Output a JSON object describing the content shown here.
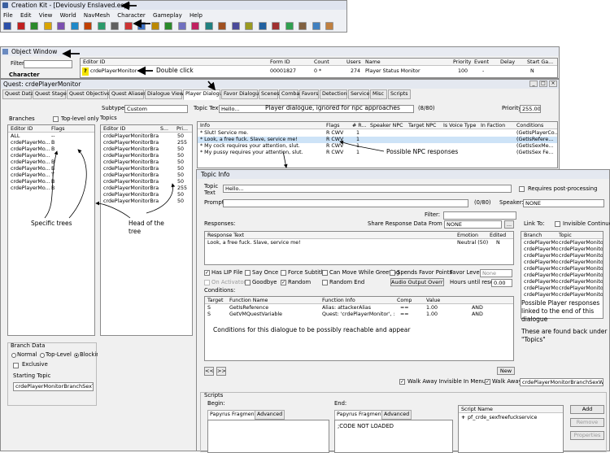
{
  "ck": {
    "title": "Creation Kit - [Deviously Enslaved.esp]",
    "menu": [
      "File",
      "Edit",
      "View",
      "World",
      "NavMesh",
      "Character",
      "Gameplay",
      "Help"
    ],
    "toolbar_colors": [
      "#2b4fa8",
      "#c02020",
      "#2b8a2b",
      "#d9a400",
      "#7a4fb0",
      "#1e88c8",
      "#c04000",
      "#2a9a6a",
      "#606060",
      "#cc3333",
      "#3b6fc4",
      "#bb8800",
      "#2a8a2a",
      "#7070c0",
      "#c02060",
      "#208080",
      "#a05020",
      "#4a4a9a",
      "#9a9a20",
      "#2060a0",
      "#a03030",
      "#30a050",
      "#806040",
      "#4080c0",
      "#c08040"
    ]
  },
  "object_window": {
    "title": "Object Window",
    "filter_label": "Filter",
    "filter_value": "",
    "tree_item": "Character",
    "columns": [
      "Editor ID",
      "Form ID",
      "Count",
      "Users",
      "Name",
      "Priority",
      "Event",
      "Delay",
      "Start Ga..."
    ],
    "row": {
      "flag": "?",
      "editor_id": "crdePlayerMonitor",
      "form_id": "00001827",
      "count": "0 *",
      "users": "274",
      "name": "Player Status Monitor",
      "priority": "100",
      "event": "-",
      "delay": "",
      "start": "N"
    }
  },
  "quest": {
    "title": "Quest: crdePlayerMonitor",
    "tabs": [
      "Quest Data",
      "Quest Stages",
      "Quest Objectives",
      "Quest Aliases",
      "Dialogue Views",
      "Player Dialogue",
      "Favor Dialogue",
      "Scenes",
      "Combat",
      "Favors",
      "Detection",
      "Service",
      "Misc",
      "Scripts"
    ],
    "active_tab": "Player Dialogue",
    "branches_label": "Branches",
    "top_level_only": "Top-level only",
    "branch_cols": [
      "Editor ID",
      "Flags"
    ],
    "branches": [
      {
        "id": "ALL",
        "flags": "--"
      },
      {
        "id": "crdePlayerMo...",
        "flags": "B"
      },
      {
        "id": "crdePlayerMo...",
        "flags": "B"
      },
      {
        "id": "crdePlayerMo...",
        "flags": ""
      },
      {
        "id": "crdePlayerMo...",
        "flags": "B"
      },
      {
        "id": "crdePlayerMo...",
        "flags": "B"
      },
      {
        "id": "crdePlayerMo...",
        "flags": "T"
      },
      {
        "id": "crdePlayerMo...",
        "flags": "B"
      },
      {
        "id": "crdePlayerMo...",
        "flags": "B"
      }
    ],
    "subtype_label": "Subtype",
    "subtype_value": "Custom",
    "topics_label": "Topics",
    "topic_cols": [
      "Editor ID",
      "S...",
      "Pri..."
    ],
    "topics": [
      {
        "id": "crdePlayerMonitorBran...",
        "s": "",
        "p": "50"
      },
      {
        "id": "crdePlayerMonitorBran...",
        "s": "",
        "p": "255"
      },
      {
        "id": "crdePlayerMonitorBran...",
        "s": "",
        "p": "50"
      },
      {
        "id": "crdePlayerMonitorBran...",
        "s": "",
        "p": "50"
      },
      {
        "id": "crdePlayerMonitorBran...",
        "s": "",
        "p": "50"
      },
      {
        "id": "crdePlayerMonitorBran...",
        "s": "",
        "p": "50"
      },
      {
        "id": "crdePlayerMonitorBran...",
        "s": "",
        "p": "50"
      },
      {
        "id": "crdePlayerMonitorBran...",
        "s": "",
        "p": "50"
      },
      {
        "id": "crdePlayerMonitorBran...",
        "s": "",
        "p": "255"
      },
      {
        "id": "crdePlayerMonitorBran...",
        "s": "",
        "p": "50"
      },
      {
        "id": "crdePlayerMonitorBran...",
        "s": "",
        "p": "50"
      }
    ],
    "topic_text_label": "Topic Text",
    "topic_text_value": "Hello...",
    "topic_text_count": "(8/80)",
    "priority_label": "Priority",
    "priority_value": "255.00",
    "info_cols": [
      "Info",
      "Flags",
      "# R...",
      "Speaker NPC",
      "Target NPC",
      "Is Voice Type",
      "In Faction",
      "Conditions"
    ],
    "infos": [
      {
        "info": "* Slut! Service me.",
        "flags": "R CWV",
        "r": "1",
        "cond": "(GetIsPlayerCo..."
      },
      {
        "info": "* Look, a free fuck. Slave, service me!",
        "flags": "R CWV",
        "r": "1",
        "cond": "(GetIsRefere..."
      },
      {
        "info": "* My cock requires your attention, slut.",
        "flags": "R CWV",
        "r": "1",
        "cond": "(GetIsSexMe..."
      },
      {
        "info": "* My pussy requires your attention, slut.",
        "flags": "R CWV",
        "r": "1",
        "cond": "(GetIsSex Fe..."
      }
    ],
    "branch_data_label": "Branch Data",
    "branch_types": [
      "Normal",
      "Top-Level",
      "Blocking"
    ],
    "exclusive_label": "Exclusive",
    "starting_topic_label": "Starting Topic",
    "starting_topic_value": "crdePlayerMonitorBranchSexTo..."
  },
  "topic_info": {
    "title": "Topic Info",
    "topic_label": "Topic Text",
    "topic_value": "Hello...",
    "requires_pp": "Requires post-processing",
    "prompt_label": "Prompt:",
    "prompt_count": "(0/80)",
    "speaker_label": "Speaker:",
    "speaker_value": "NONE",
    "filter_label": "Filter:",
    "responses_label": "Responses:",
    "share_label": "Share Response Data From Info:",
    "share_value": "NONE",
    "share_btn": "...",
    "link_to_label": "Link To:",
    "invisible_continue": "Invisible Continue",
    "resp_cols": [
      "Response Text",
      "Emotion",
      "Edited"
    ],
    "response": {
      "text": "Look, a free fuck. Slave, service me!",
      "emotion": "Neutral (50)",
      "edited": "N"
    },
    "link_cols": [
      "Branch",
      "Topic"
    ],
    "links": [
      {
        "b": "crdePlayerMo...",
        "t": "crdePlayerMonitorBr..."
      },
      {
        "b": "crdePlayerMo...",
        "t": "crdePlayerMonitorBr..."
      },
      {
        "b": "crdePlayerMo...",
        "t": "crdePlayerMonitorBr..."
      },
      {
        "b": "crdePlayerMo...",
        "t": "crdePlayerMonitorBr..."
      },
      {
        "b": "crdePlayerMo...",
        "t": "crdePlayerMonitorBr..."
      },
      {
        "b": "crdePlayerMo...",
        "t": "crdePlayerMonitorBr..."
      },
      {
        "b": "crdePlayerMo...",
        "t": "crdePlayerMonitorBr..."
      },
      {
        "b": "crdePlayerMo...",
        "t": "crdePlayerMonitorBr..."
      },
      {
        "b": "crdePlayerMo...",
        "t": "crdePlayerMonitorBr..."
      }
    ],
    "checks_row1": [
      "Has LIP File",
      "Say Once",
      "Force Subtitle",
      "Can Move While Greeting",
      "Spends Favor Points"
    ],
    "checks_row2": [
      "On Activator",
      "Goodbye",
      "Random",
      "Random End"
    ],
    "audio_btn": "Audio Output Override",
    "favor_label": "Favor Level:",
    "favor_value": "None",
    "hours_label": "Hours until reset:",
    "hours_value": "0.00",
    "conditions_label": "Conditions:",
    "cond_cols": [
      "Target",
      "Function Name",
      "Function Info",
      "Comp",
      "Value",
      ""
    ],
    "conditions": [
      {
        "target": "S",
        "fn": "GetIsReference",
        "info": "Alias: attackerAlias",
        "comp": "==",
        "value": "1.00",
        "op": "AND"
      },
      {
        "target": "S",
        "fn": "GetVMQuestVariable",
        "info": "Quest: 'crdePlayerMonitor', :...",
        "comp": "==",
        "value": "1.00",
        "op": "AND"
      }
    ],
    "new_btn": "New",
    "prev_btn": "<<",
    "next_btn": ">>",
    "walk_away_invisible": "Walk Away Invisible In Menu",
    "walk_away_label": "Walk Away:",
    "walk_away_value": "crdePlayerMonitorBranchSexWalk...",
    "scripts_label": "Scripts",
    "begin_label": "Begin:",
    "end_label": "End:",
    "papyrus_tab": "Papyrus Fragment",
    "advanced_tab": "Advanced",
    "end_code": ";CODE NOT LOADED",
    "script_name_col": "Script Name",
    "script_name": "pf_crde_sexfreefuckservice",
    "add_btn": "Add",
    "remove_btn": "Remove",
    "properties_btn": "Properties"
  },
  "annotations": {
    "double_click": "Double click",
    "player_dialogue": "Player dialogue, ignored for npc approaches",
    "possible_npc": "Possible NPC responses",
    "specific_trees": "Specific trees",
    "head_tree_1": "Head of the",
    "head_tree_2": "tree",
    "conditions_note": "Conditions for this dialogue to be possibly reachable and appear",
    "player_resp_1": "Possible Player responses",
    "player_resp_2": "linked to the end of this",
    "player_resp_3": "dialogue",
    "found_back_1": "These are found back under",
    "found_back_2": "\"Topics\""
  }
}
